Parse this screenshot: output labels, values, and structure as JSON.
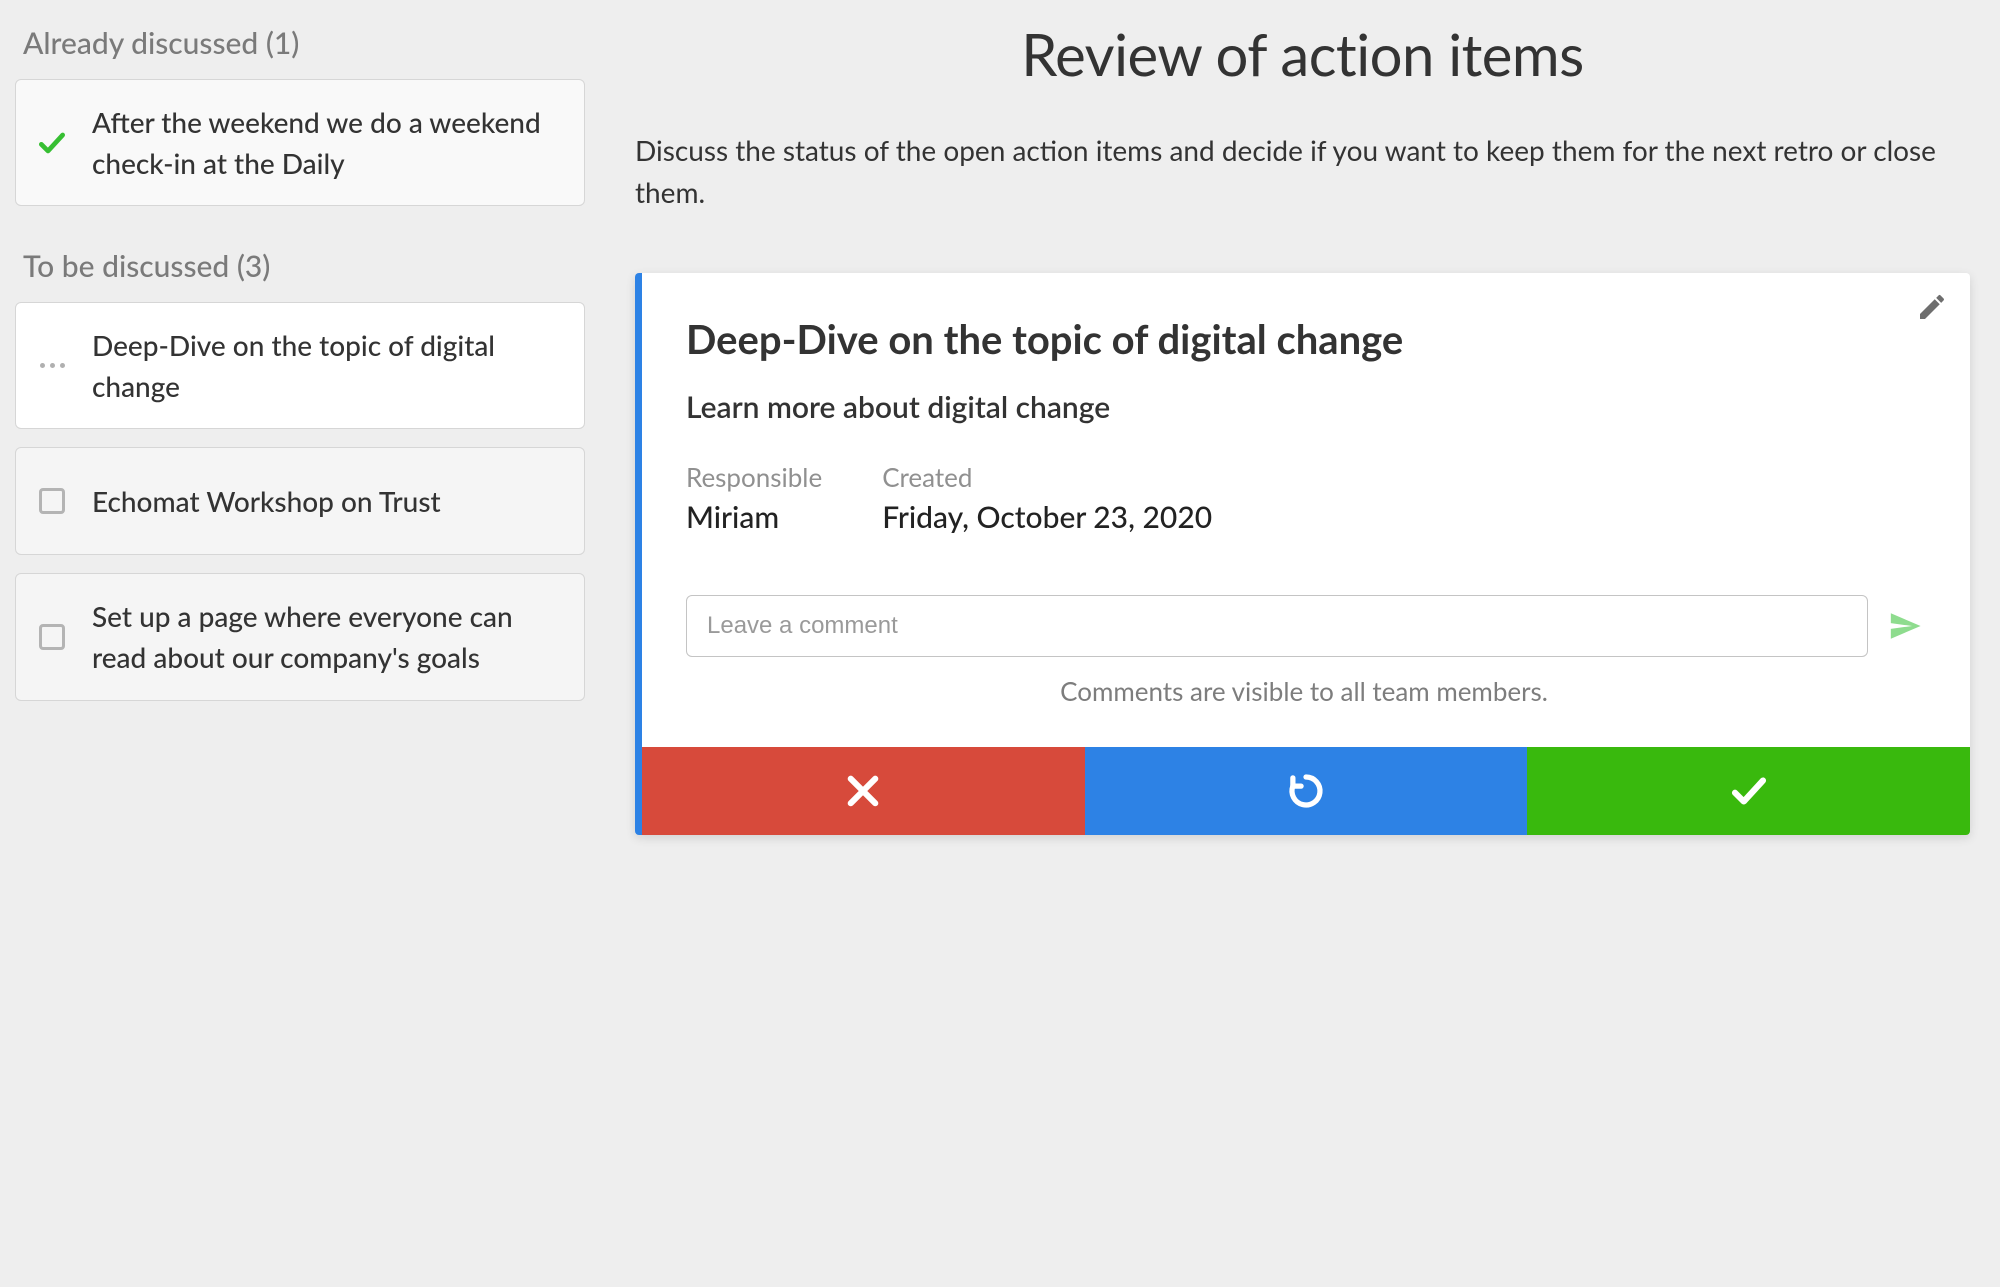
{
  "sidebar": {
    "discussed_heading": "Already discussed (1)",
    "to_discuss_heading": "To be discussed (3)",
    "discussed_items": [
      {
        "text": "After the weekend we do a weekend check-in at the Daily"
      }
    ],
    "to_discuss_items": [
      {
        "text": "Deep-Dive on the topic of digital change",
        "active": true
      },
      {
        "text": "Echomat Workshop on Trust",
        "active": false
      },
      {
        "text": "Set up a page where everyone can read about our company's goals",
        "active": false
      }
    ]
  },
  "main": {
    "title": "Review of action items",
    "description": "Discuss the status of the open action items and decide if you want to keep them for the next retro or close them."
  },
  "action": {
    "title": "Deep-Dive on the topic of digital change",
    "subtitle": "Learn more about digital change",
    "responsible_label": "Responsible",
    "responsible_value": "Miriam",
    "created_label": "Created",
    "created_value": "Friday, October 23, 2020",
    "comment_placeholder": "Leave a comment",
    "comment_note": "Comments are visible to all team members."
  },
  "colors": {
    "accent_blue": "#2d82e5",
    "danger_red": "#d74a3b",
    "success_green": "#39b90d",
    "check_green": "#37bf33"
  }
}
